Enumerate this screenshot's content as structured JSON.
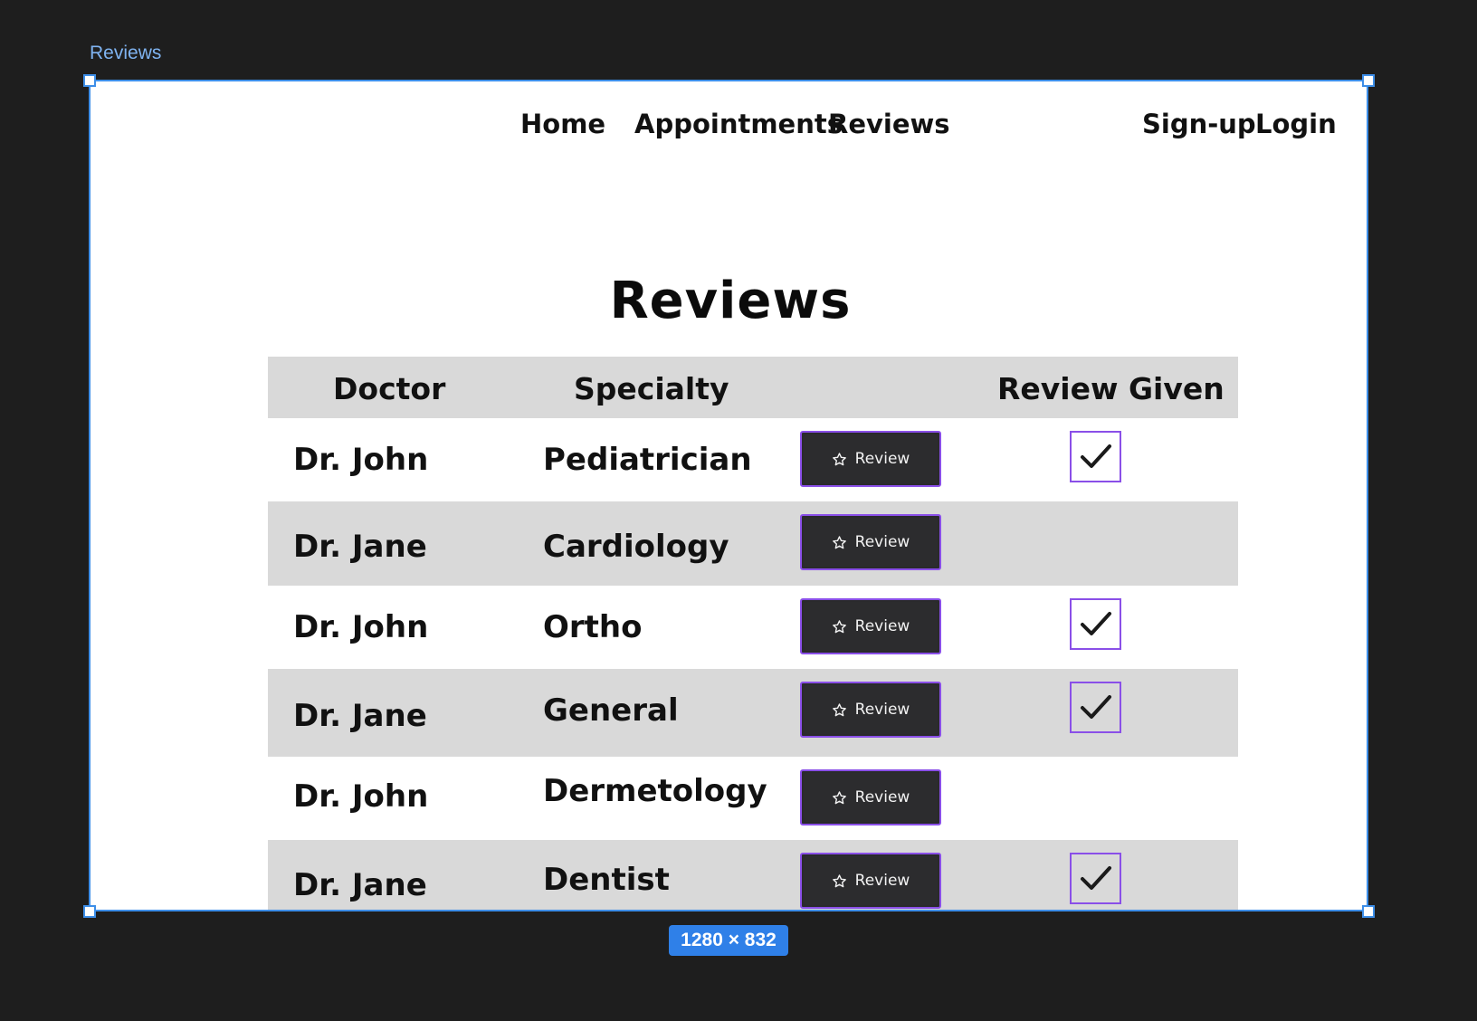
{
  "canvas": {
    "frame_label": "Reviews",
    "size_badge": "1280 × 832",
    "selection_color": "#3d8ee8"
  },
  "nav": {
    "home": "Home",
    "appointments": "Appointments",
    "reviews": "Reviews",
    "signup": "Sign-up",
    "login": "Login"
  },
  "page": {
    "title": "Reviews"
  },
  "table": {
    "headers": {
      "doctor": "Doctor",
      "specialty": "Specialty",
      "action": "",
      "review_given": "Review Given"
    },
    "button_label": "Review",
    "button_icon": "star-icon",
    "checkbox_accent": "#8a4fe8",
    "rows": [
      {
        "doctor": "Dr. John",
        "specialty": "Pediatrician",
        "review_given": true
      },
      {
        "doctor": "Dr. Jane",
        "specialty": "Cardiology",
        "review_given": false
      },
      {
        "doctor": "Dr. John",
        "specialty": "Ortho",
        "review_given": true
      },
      {
        "doctor": "Dr. Jane",
        "specialty": "General",
        "review_given": true
      },
      {
        "doctor": "Dr. John",
        "specialty": "Dermetology",
        "review_given": false
      },
      {
        "doctor": "Dr. Jane",
        "specialty": "Dentist",
        "review_given": true
      }
    ]
  }
}
